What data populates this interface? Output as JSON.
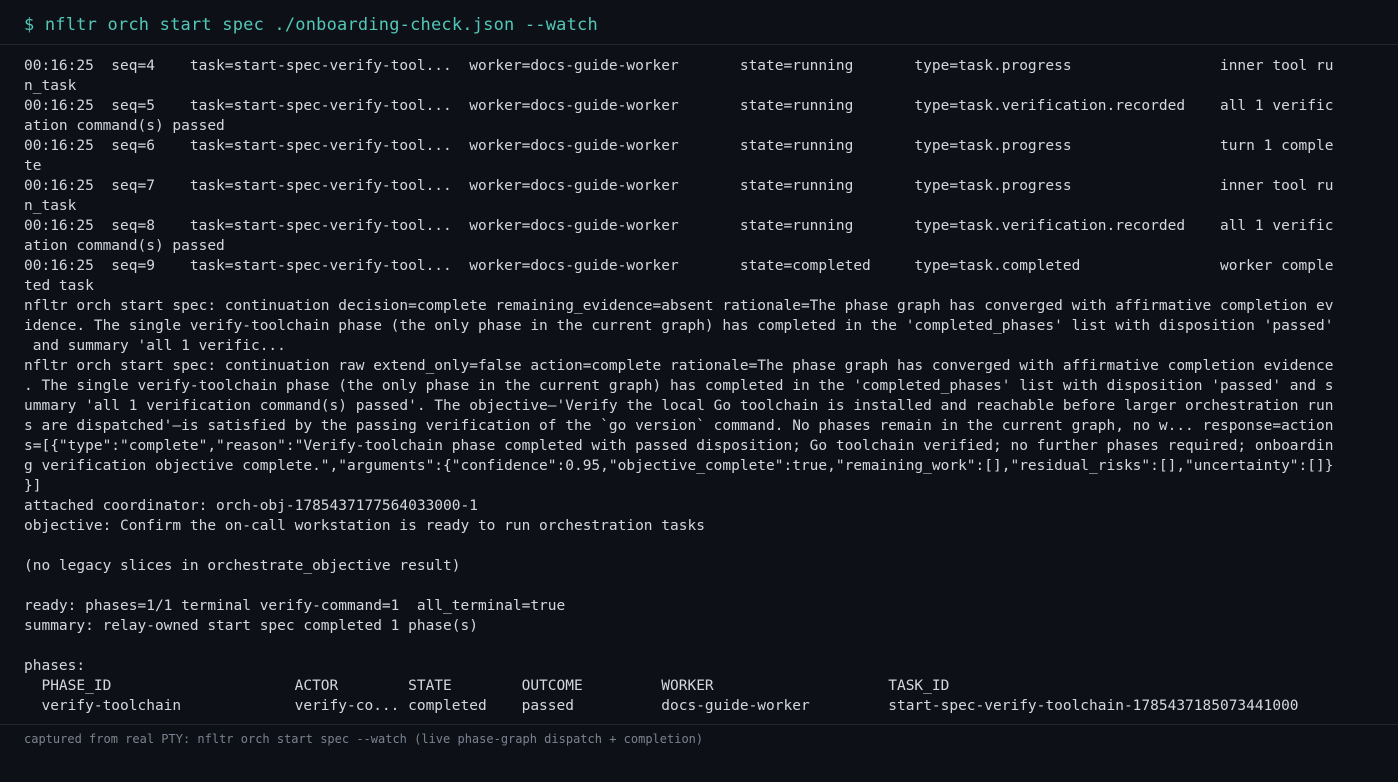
{
  "prompt": "$ nfltr orch start spec ./onboarding-check.json --watch",
  "lines": [
    "00:16:25  seq=4    task=start-spec-verify-tool...  worker=docs-guide-worker       state=running       type=task.progress                 inner tool ru",
    "n_task",
    "00:16:25  seq=5    task=start-spec-verify-tool...  worker=docs-guide-worker       state=running       type=task.verification.recorded    all 1 verific",
    "ation command(s) passed",
    "00:16:25  seq=6    task=start-spec-verify-tool...  worker=docs-guide-worker       state=running       type=task.progress                 turn 1 comple",
    "te",
    "00:16:25  seq=7    task=start-spec-verify-tool...  worker=docs-guide-worker       state=running       type=task.progress                 inner tool ru",
    "n_task",
    "00:16:25  seq=8    task=start-spec-verify-tool...  worker=docs-guide-worker       state=running       type=task.verification.recorded    all 1 verific",
    "ation command(s) passed",
    "00:16:25  seq=9    task=start-spec-verify-tool...  worker=docs-guide-worker       state=completed     type=task.completed                worker comple",
    "ted task",
    "nfltr orch start spec: continuation decision=complete remaining_evidence=absent rationale=The phase graph has converged with affirmative completion ev",
    "idence. The single verify-toolchain phase (the only phase in the current graph) has completed in the 'completed_phases' list with disposition 'passed'",
    " and summary 'all 1 verific...",
    "nfltr orch start spec: continuation raw extend_only=false action=complete rationale=The phase graph has converged with affirmative completion evidence",
    ". The single verify-toolchain phase (the only phase in the current graph) has completed in the 'completed_phases' list with disposition 'passed' and s",
    "ummary 'all 1 verification command(s) passed'. The objective—'Verify the local Go toolchain is installed and reachable before larger orchestration run",
    "s are dispatched'—is satisfied by the passing verification of the `go version` command. No phases remain in the current graph, no w... response=action",
    "s=[{\"type\":\"complete\",\"reason\":\"Verify-toolchain phase completed with passed disposition; Go toolchain verified; no further phases required; onboardin",
    "g verification objective complete.\",\"arguments\":{\"confidence\":0.95,\"objective_complete\":true,\"remaining_work\":[],\"residual_risks\":[],\"uncertainty\":[]}",
    "}]",
    "attached coordinator: orch-obj-1785437177564033000-1",
    "objective: Confirm the on-call workstation is ready to run orchestration tasks",
    "",
    "(no legacy slices in orchestrate_objective result)",
    "",
    "ready: phases=1/1 terminal verify-command=1  all_terminal=true",
    "summary: relay-owned start spec completed 1 phase(s)",
    "",
    "phases:",
    "  PHASE_ID                     ACTOR        STATE        OUTCOME         WORKER                    TASK_ID",
    "  verify-toolchain             verify-co... completed    passed          docs-guide-worker         start-spec-verify-toolchain-1785437185073441000"
  ],
  "footer": "captured from real PTY: nfltr orch start spec --watch (live phase-graph dispatch + completion)"
}
